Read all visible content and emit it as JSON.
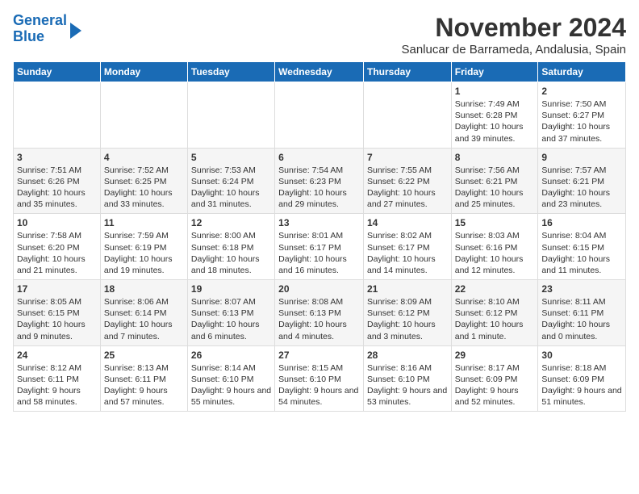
{
  "logo": {
    "line1": "General",
    "line2": "Blue"
  },
  "title": "November 2024",
  "subtitle": "Sanlucar de Barrameda, Andalusia, Spain",
  "weekdays": [
    "Sunday",
    "Monday",
    "Tuesday",
    "Wednesday",
    "Thursday",
    "Friday",
    "Saturday"
  ],
  "weeks": [
    [
      {
        "day": "",
        "info": ""
      },
      {
        "day": "",
        "info": ""
      },
      {
        "day": "",
        "info": ""
      },
      {
        "day": "",
        "info": ""
      },
      {
        "day": "",
        "info": ""
      },
      {
        "day": "1",
        "info": "Sunrise: 7:49 AM\nSunset: 6:28 PM\nDaylight: 10 hours and 39 minutes."
      },
      {
        "day": "2",
        "info": "Sunrise: 7:50 AM\nSunset: 6:27 PM\nDaylight: 10 hours and 37 minutes."
      }
    ],
    [
      {
        "day": "3",
        "info": "Sunrise: 7:51 AM\nSunset: 6:26 PM\nDaylight: 10 hours and 35 minutes."
      },
      {
        "day": "4",
        "info": "Sunrise: 7:52 AM\nSunset: 6:25 PM\nDaylight: 10 hours and 33 minutes."
      },
      {
        "day": "5",
        "info": "Sunrise: 7:53 AM\nSunset: 6:24 PM\nDaylight: 10 hours and 31 minutes."
      },
      {
        "day": "6",
        "info": "Sunrise: 7:54 AM\nSunset: 6:23 PM\nDaylight: 10 hours and 29 minutes."
      },
      {
        "day": "7",
        "info": "Sunrise: 7:55 AM\nSunset: 6:22 PM\nDaylight: 10 hours and 27 minutes."
      },
      {
        "day": "8",
        "info": "Sunrise: 7:56 AM\nSunset: 6:21 PM\nDaylight: 10 hours and 25 minutes."
      },
      {
        "day": "9",
        "info": "Sunrise: 7:57 AM\nSunset: 6:21 PM\nDaylight: 10 hours and 23 minutes."
      }
    ],
    [
      {
        "day": "10",
        "info": "Sunrise: 7:58 AM\nSunset: 6:20 PM\nDaylight: 10 hours and 21 minutes."
      },
      {
        "day": "11",
        "info": "Sunrise: 7:59 AM\nSunset: 6:19 PM\nDaylight: 10 hours and 19 minutes."
      },
      {
        "day": "12",
        "info": "Sunrise: 8:00 AM\nSunset: 6:18 PM\nDaylight: 10 hours and 18 minutes."
      },
      {
        "day": "13",
        "info": "Sunrise: 8:01 AM\nSunset: 6:17 PM\nDaylight: 10 hours and 16 minutes."
      },
      {
        "day": "14",
        "info": "Sunrise: 8:02 AM\nSunset: 6:17 PM\nDaylight: 10 hours and 14 minutes."
      },
      {
        "day": "15",
        "info": "Sunrise: 8:03 AM\nSunset: 6:16 PM\nDaylight: 10 hours and 12 minutes."
      },
      {
        "day": "16",
        "info": "Sunrise: 8:04 AM\nSunset: 6:15 PM\nDaylight: 10 hours and 11 minutes."
      }
    ],
    [
      {
        "day": "17",
        "info": "Sunrise: 8:05 AM\nSunset: 6:15 PM\nDaylight: 10 hours and 9 minutes."
      },
      {
        "day": "18",
        "info": "Sunrise: 8:06 AM\nSunset: 6:14 PM\nDaylight: 10 hours and 7 minutes."
      },
      {
        "day": "19",
        "info": "Sunrise: 8:07 AM\nSunset: 6:13 PM\nDaylight: 10 hours and 6 minutes."
      },
      {
        "day": "20",
        "info": "Sunrise: 8:08 AM\nSunset: 6:13 PM\nDaylight: 10 hours and 4 minutes."
      },
      {
        "day": "21",
        "info": "Sunrise: 8:09 AM\nSunset: 6:12 PM\nDaylight: 10 hours and 3 minutes."
      },
      {
        "day": "22",
        "info": "Sunrise: 8:10 AM\nSunset: 6:12 PM\nDaylight: 10 hours and 1 minute."
      },
      {
        "day": "23",
        "info": "Sunrise: 8:11 AM\nSunset: 6:11 PM\nDaylight: 10 hours and 0 minutes."
      }
    ],
    [
      {
        "day": "24",
        "info": "Sunrise: 8:12 AM\nSunset: 6:11 PM\nDaylight: 9 hours and 58 minutes."
      },
      {
        "day": "25",
        "info": "Sunrise: 8:13 AM\nSunset: 6:11 PM\nDaylight: 9 hours and 57 minutes."
      },
      {
        "day": "26",
        "info": "Sunrise: 8:14 AM\nSunset: 6:10 PM\nDaylight: 9 hours and 55 minutes."
      },
      {
        "day": "27",
        "info": "Sunrise: 8:15 AM\nSunset: 6:10 PM\nDaylight: 9 hours and 54 minutes."
      },
      {
        "day": "28",
        "info": "Sunrise: 8:16 AM\nSunset: 6:10 PM\nDaylight: 9 hours and 53 minutes."
      },
      {
        "day": "29",
        "info": "Sunrise: 8:17 AM\nSunset: 6:09 PM\nDaylight: 9 hours and 52 minutes."
      },
      {
        "day": "30",
        "info": "Sunrise: 8:18 AM\nSunset: 6:09 PM\nDaylight: 9 hours and 51 minutes."
      }
    ]
  ]
}
